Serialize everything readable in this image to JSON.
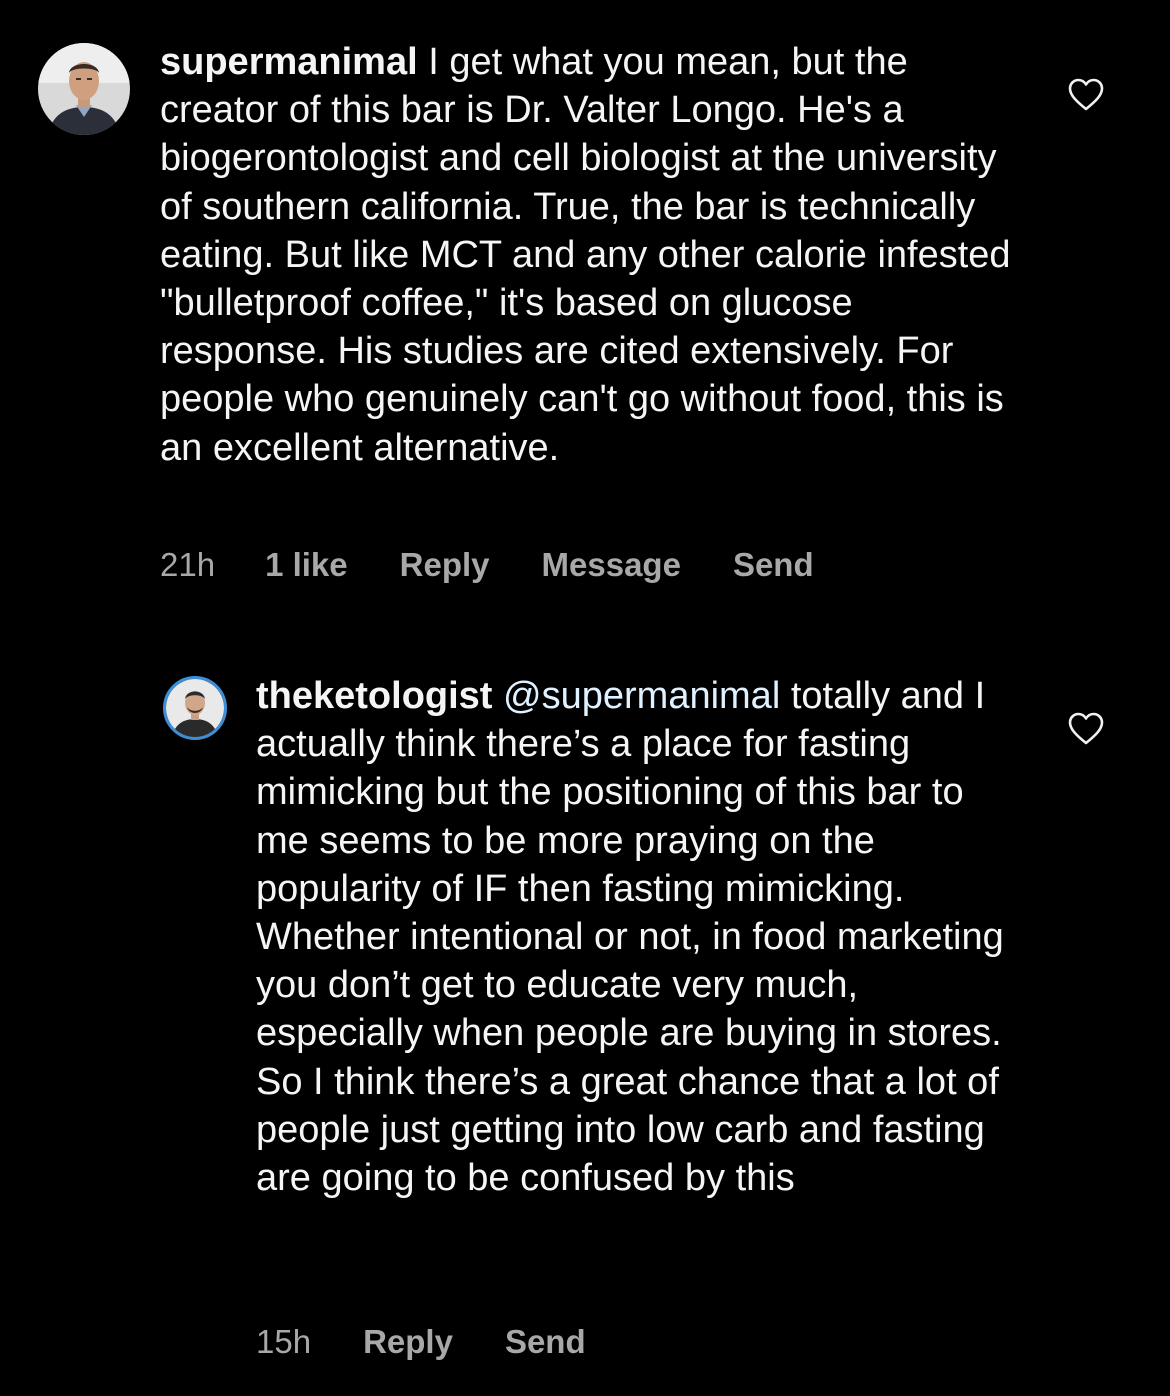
{
  "comments": [
    {
      "username": "supermanimal",
      "text": "I get what you mean, but the creator of this bar is Dr. Valter Longo. He's a biogerontologist and cell biologist at the university of southern california. True, the bar is technically eating. But like MCT and any other calorie infested \"bulletproof coffee,\" it's based on glucose response. His studies are cited extensively. For people who genuinely can't go without food, this is an excellent alternative.",
      "time": "21h",
      "likes": "1 like",
      "reply": "Reply",
      "message": "Message",
      "send": "Send",
      "avatar_icon": "profile-photo",
      "like_icon": "heart-outline-icon"
    },
    {
      "username": "theketologist",
      "mention": "@supermanimal",
      "text": "totally and I actually think there’s a place for fasting mimicking but the positioning of this bar to me seems to be more praying on the popularity of IF then fasting mimicking. Whether intentional or not, in food marketing you don’t get to educate very much, especially when people are buying in stores. So I think there’s a great chance that a lot of people just getting into low carb and fasting are going to be confused by this",
      "time": "15h",
      "reply": "Reply",
      "send": "Send",
      "avatar_icon": "profile-photo",
      "like_icon": "heart-outline-icon"
    }
  ],
  "colors": {
    "background": "#000000",
    "text": "#f5f5f5",
    "secondary": "#a8a8a8",
    "mention": "#e0f1ff"
  }
}
